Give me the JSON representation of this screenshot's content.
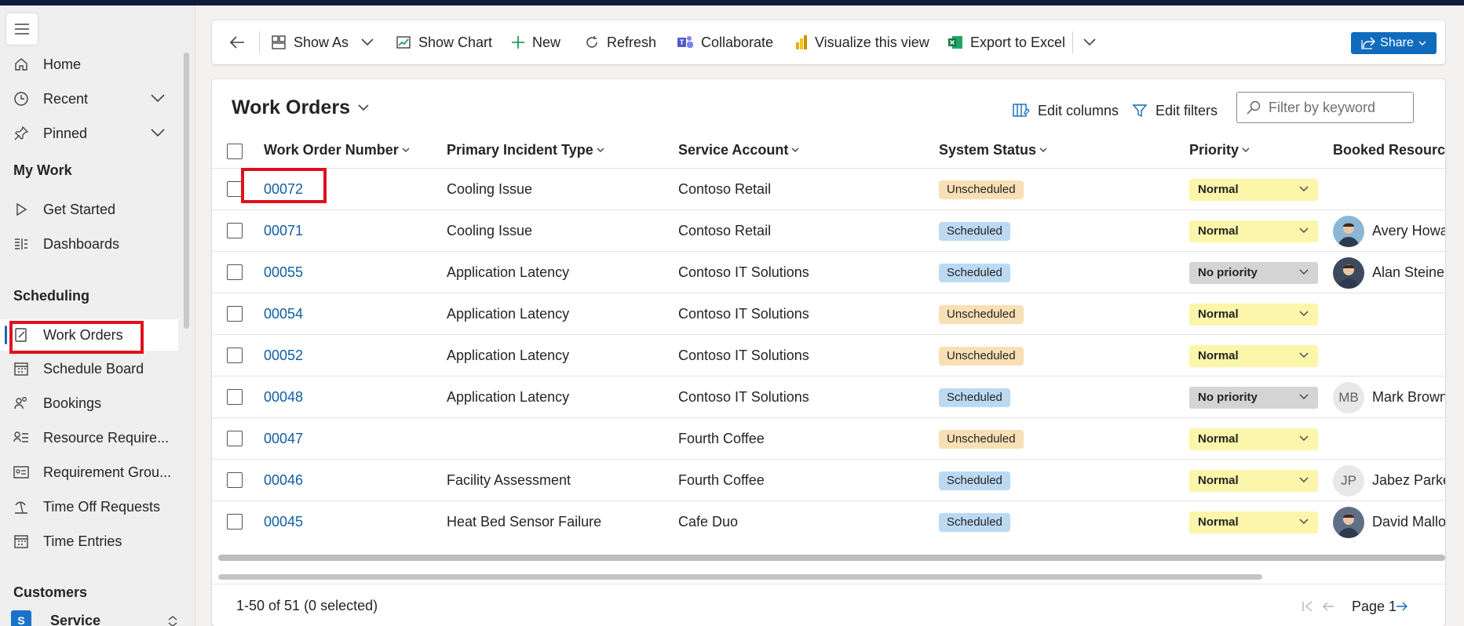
{
  "sidebar": {
    "items_top": [
      {
        "label": "Home"
      },
      {
        "label": "Recent"
      },
      {
        "label": "Pinned"
      }
    ],
    "my_work_heading": "My Work",
    "my_work_items": [
      {
        "label": "Get Started"
      },
      {
        "label": "Dashboards"
      }
    ],
    "scheduling_heading": "Scheduling",
    "scheduling_items": [
      {
        "label": "Work Orders"
      },
      {
        "label": "Schedule Board"
      },
      {
        "label": "Bookings"
      },
      {
        "label": "Resource Require..."
      },
      {
        "label": "Requirement Grou..."
      },
      {
        "label": "Time Off Requests"
      },
      {
        "label": "Time Entries"
      }
    ],
    "customers_heading": "Customers",
    "area": {
      "badge": "S",
      "label": "Service"
    }
  },
  "commandbar": {
    "show_as": "Show As",
    "show_chart": "Show Chart",
    "new": "New",
    "refresh": "Refresh",
    "collaborate": "Collaborate",
    "visualize": "Visualize this view",
    "export": "Export to Excel",
    "share": "Share"
  },
  "view": {
    "title": "Work Orders",
    "edit_columns": "Edit columns",
    "edit_filters": "Edit filters",
    "filter_placeholder": "Filter by keyword"
  },
  "columns": {
    "number": "Work Order Number",
    "incident": "Primary Incident Type",
    "account": "Service Account",
    "status": "System Status",
    "priority": "Priority",
    "resources": "Booked Resources"
  },
  "rows": [
    {
      "number": "00072",
      "incident": "Cooling Issue",
      "account": "Contoso Retail",
      "status": "Unscheduled",
      "priority": "Normal",
      "resource": ""
    },
    {
      "number": "00071",
      "incident": "Cooling Issue",
      "account": "Contoso Retail",
      "status": "Scheduled",
      "priority": "Normal",
      "resource": "Avery Howa"
    },
    {
      "number": "00055",
      "incident": "Application Latency",
      "account": "Contoso IT Solutions",
      "status": "Scheduled",
      "priority": "No priority",
      "resource": "Alan Steiner"
    },
    {
      "number": "00054",
      "incident": "Application Latency",
      "account": "Contoso IT Solutions",
      "status": "Unscheduled",
      "priority": "Normal",
      "resource": ""
    },
    {
      "number": "00052",
      "incident": "Application Latency",
      "account": "Contoso IT Solutions",
      "status": "Unscheduled",
      "priority": "Normal",
      "resource": ""
    },
    {
      "number": "00048",
      "incident": "Application Latency",
      "account": "Contoso IT Solutions",
      "status": "Scheduled",
      "priority": "No priority",
      "resource": "Mark Brown",
      "initials": "MB"
    },
    {
      "number": "00047",
      "incident": "",
      "account": "Fourth Coffee",
      "status": "Unscheduled",
      "priority": "Normal",
      "resource": ""
    },
    {
      "number": "00046",
      "incident": "Facility Assessment",
      "account": "Fourth Coffee",
      "status": "Scheduled",
      "priority": "Normal",
      "resource": "Jabez Parker",
      "initials": "JP"
    },
    {
      "number": "00045",
      "incident": "Heat Bed Sensor Failure",
      "account": "Cafe Duo",
      "status": "Scheduled",
      "priority": "Normal",
      "resource": "David Mallo"
    }
  ],
  "footer": {
    "count": "1-50 of 51 (0 selected)",
    "page": "Page 1"
  },
  "colors": {
    "accent": "#0f6cbd",
    "link": "#115ea3",
    "unscheduled": "#f8dfb5",
    "scheduled": "#bcd9f2",
    "priority_normal": "#fbf6a9",
    "priority_none": "#d4d4d4",
    "highlight_box": "#e0101d"
  }
}
